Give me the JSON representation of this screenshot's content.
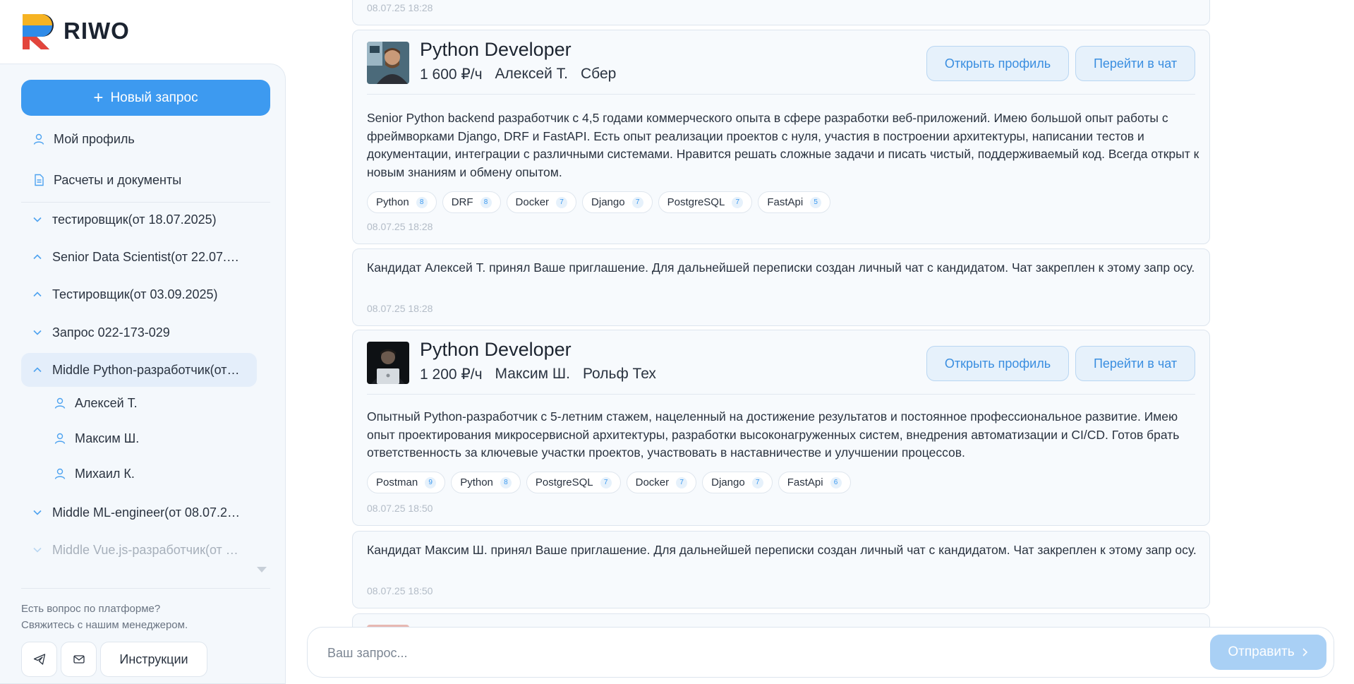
{
  "app": {
    "logo_text": "RIWO"
  },
  "sidebar": {
    "new_request_label": "Новый запрос",
    "menu": [
      {
        "label": "Мой профиль",
        "icon": "user-icon"
      },
      {
        "label": "Расчеты и документы",
        "icon": "document-icon"
      }
    ],
    "requests": [
      {
        "label": "тестировщик(от 18.07.2025)",
        "chevron": "down"
      },
      {
        "label": "Senior Data Scientist(от 22.07.2…",
        "chevron": "up"
      },
      {
        "label": "Тестировщик(от 03.09.2025)",
        "chevron": "up"
      },
      {
        "label": "Запрос 022-173-029",
        "chevron": "down"
      },
      {
        "label": "Middle Python-разработчик(от…",
        "chevron": "up",
        "active": true
      },
      {
        "label": "Middle ML-engineer(от 08.07.20…",
        "chevron": "down"
      },
      {
        "label": "Middle Vue.js-разработчик(от …",
        "chevron": "down",
        "faded": true
      }
    ],
    "candidates": [
      "Алексей Т.",
      "Максим Ш.",
      "Михаил К."
    ],
    "help_line1": "Есть вопрос по платформе?",
    "help_line2": "Свяжитесь с нашим менеджером.",
    "instructions_label": "Инструкции"
  },
  "feed": {
    "top_timestamp": "08.07.25 18:28",
    "cards": [
      {
        "title": "Python Developer",
        "rate": "1 600 ₽/ч",
        "name": "Алексей Т.",
        "company": "Сбер",
        "open_profile": "Открыть профиль",
        "go_chat": "Перейти в чат",
        "description": "Senior Python backend разработчик с 4,5 годами коммерческого опыта в сфере разработки веб-приложений. Имею большой опыт работы с фреймворками Django, DRF и FastAPI. Есть опыт реализации проектов с нуля, участия в построении архитектуры, написании тестов и документации, интеграции с различными системами. Нравится решать сложные задачи и писать чистый, поддерживаемый код. Всегда открыт к новым знаниям и обмену опытом.",
        "tags": [
          {
            "name": "Python",
            "n": "8"
          },
          {
            "name": "DRF",
            "n": "8"
          },
          {
            "name": "Docker",
            "n": "7"
          },
          {
            "name": "Django",
            "n": "7"
          },
          {
            "name": "PostgreSQL",
            "n": "7"
          },
          {
            "name": "FastApi",
            "n": "5"
          }
        ],
        "timestamp": "08.07.25 18:28"
      },
      {
        "title": "Python Developer",
        "rate": "1 200 ₽/ч",
        "name": "Максим Ш.",
        "company": "Рольф Тех",
        "open_profile": "Открыть профиль",
        "go_chat": "Перейти в чат",
        "description": "Опытный Python-разработчик с 5-летним стажем, нацеленный на достижение результатов и постоянное профессиональное развитие. Имею опыт проектирования микросервисной архитектуры, разработки высоконагруженных систем, внедрения автоматизации и CI/CD. Готов брать ответственность за ключевые участки проектов, участвовать в наставничестве и улучшении процессов.",
        "tags": [
          {
            "name": "Postman",
            "n": "9"
          },
          {
            "name": "Python",
            "n": "8"
          },
          {
            "name": "PostgreSQL",
            "n": "7"
          },
          {
            "name": "Docker",
            "n": "7"
          },
          {
            "name": "Django",
            "n": "7"
          },
          {
            "name": "FastApi",
            "n": "6"
          }
        ],
        "timestamp": "08.07.25 18:50"
      }
    ],
    "messages": [
      {
        "text": "Кандидат Алексей Т. принял Ваше приглашение. Для дальнейшей переписки создан личный чат с кандидатом. Чат закреплен к этому запр осу.",
        "timestamp": "08.07.25 18:28"
      },
      {
        "text": "Кандидат Максим Ш. принял Ваше приглашение. Для дальнейшей переписки создан личный чат с кандидатом. Чат закреплен к этому запр осу.",
        "timestamp": "08.07.25 18:50"
      }
    ]
  },
  "input": {
    "placeholder": "Ваш запрос...",
    "send_label": "Отправить"
  }
}
